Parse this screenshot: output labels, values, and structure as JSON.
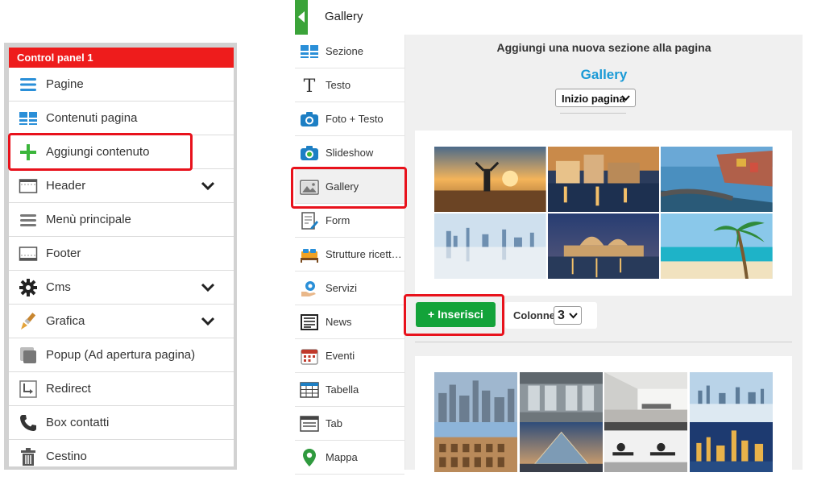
{
  "control_panel": {
    "title": "Control panel 1",
    "items": [
      {
        "label": "Pagine",
        "icon": "list-icon",
        "has_chevron": false
      },
      {
        "label": "Contenuti pagina",
        "icon": "blocks-icon",
        "has_chevron": false
      },
      {
        "label": "Aggiungi contenuto",
        "icon": "plus-icon",
        "has_chevron": false
      },
      {
        "label": "Header",
        "icon": "header-icon",
        "has_chevron": true
      },
      {
        "label": "Menù principale",
        "icon": "menu-icon",
        "has_chevron": false
      },
      {
        "label": "Footer",
        "icon": "footer-icon",
        "has_chevron": false
      },
      {
        "label": "Cms",
        "icon": "gear-icon",
        "has_chevron": true
      },
      {
        "label": "Grafica",
        "icon": "brush-icon",
        "has_chevron": true
      },
      {
        "label": "Popup (Ad apertura pagina)",
        "icon": "popup-icon",
        "has_chevron": false
      },
      {
        "label": "Redirect",
        "icon": "redirect-icon",
        "has_chevron": false
      },
      {
        "label": "Box contatti",
        "icon": "phone-icon",
        "has_chevron": false
      },
      {
        "label": "Cestino",
        "icon": "trash-icon",
        "has_chevron": false
      }
    ]
  },
  "topbar": {
    "title": "Gallery"
  },
  "section_menu": {
    "items": [
      {
        "label": "Sezione",
        "icon": "section-icon"
      },
      {
        "label": "Testo",
        "icon": "text-icon"
      },
      {
        "label": "Foto + Testo",
        "icon": "camera-icon"
      },
      {
        "label": "Slideshow",
        "icon": "slideshow-camera-icon"
      },
      {
        "label": "Gallery",
        "icon": "image-icon",
        "active": true
      },
      {
        "label": "Form",
        "icon": "form-icon"
      },
      {
        "label": "Strutture ricettive",
        "icon": "bed-icon"
      },
      {
        "label": "Servizi",
        "icon": "services-icon"
      },
      {
        "label": "News",
        "icon": "news-icon"
      },
      {
        "label": "Eventi",
        "icon": "calendar-icon"
      },
      {
        "label": "Tabella",
        "icon": "table-icon"
      },
      {
        "label": "Tab",
        "icon": "tab-icon"
      },
      {
        "label": "Mappa",
        "icon": "map-pin-icon"
      }
    ]
  },
  "main": {
    "heading": "Aggiungi una nuova sezione alla pagina",
    "section_name": "Gallery",
    "position_select": "Inizio pagina",
    "insert_button": "+ Inserisci",
    "columns_label": "Colonne",
    "columns_value": "3"
  },
  "colors": {
    "accent_red": "#ee1c1c",
    "insert_green": "#13a33a",
    "gallery_blue": "#1a9ad6",
    "highlight": "#e8121c"
  }
}
